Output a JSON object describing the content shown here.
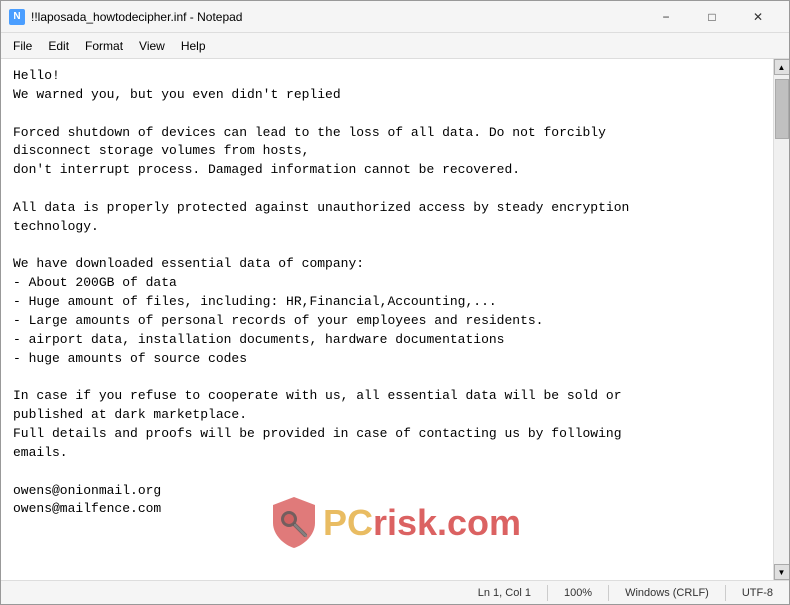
{
  "window": {
    "title": "!!laposada_howtodecipher.inf - Notepad",
    "icon_label": "N"
  },
  "title_controls": {
    "minimize": "−",
    "maximize": "□",
    "close": "✕"
  },
  "menu": {
    "items": [
      "File",
      "Edit",
      "Format",
      "View",
      "Help"
    ]
  },
  "content": {
    "text": "Hello!\nWe warned you, but you even didn't replied\n\nForced shutdown of devices can lead to the loss of all data. Do not forcibly\ndisconnect storage volumes from hosts,\ndon't interrupt process. Damaged information cannot be recovered.\n\nAll data is properly protected against unauthorized access by steady encryption\ntechnology.\n\nWe have downloaded essential data of company:\n- About 200GB of data\n- Huge amount of files, including: HR,Financial,Accounting,...\n- Large amounts of personal records of your employees and residents.\n- airport data, installation documents, hardware documentations\n- huge amounts of source codes\n\nIn case if you refuse to cooperate with us, all essential data will be sold or\npublished at dark marketplace.\nFull details and proofs will be provided in case of contacting us by following\nemails.\n\nowens@onionmail.org\nowens@mailfence.com"
  },
  "status_bar": {
    "position": "Ln 1, Col 1",
    "zoom": "100%",
    "line_ending": "Windows (CRLF)",
    "encoding": "UTF-8"
  },
  "watermark": {
    "pc_text": "PC",
    "risk_text": "risk",
    "dot_text": ".",
    "com_text": "com"
  }
}
